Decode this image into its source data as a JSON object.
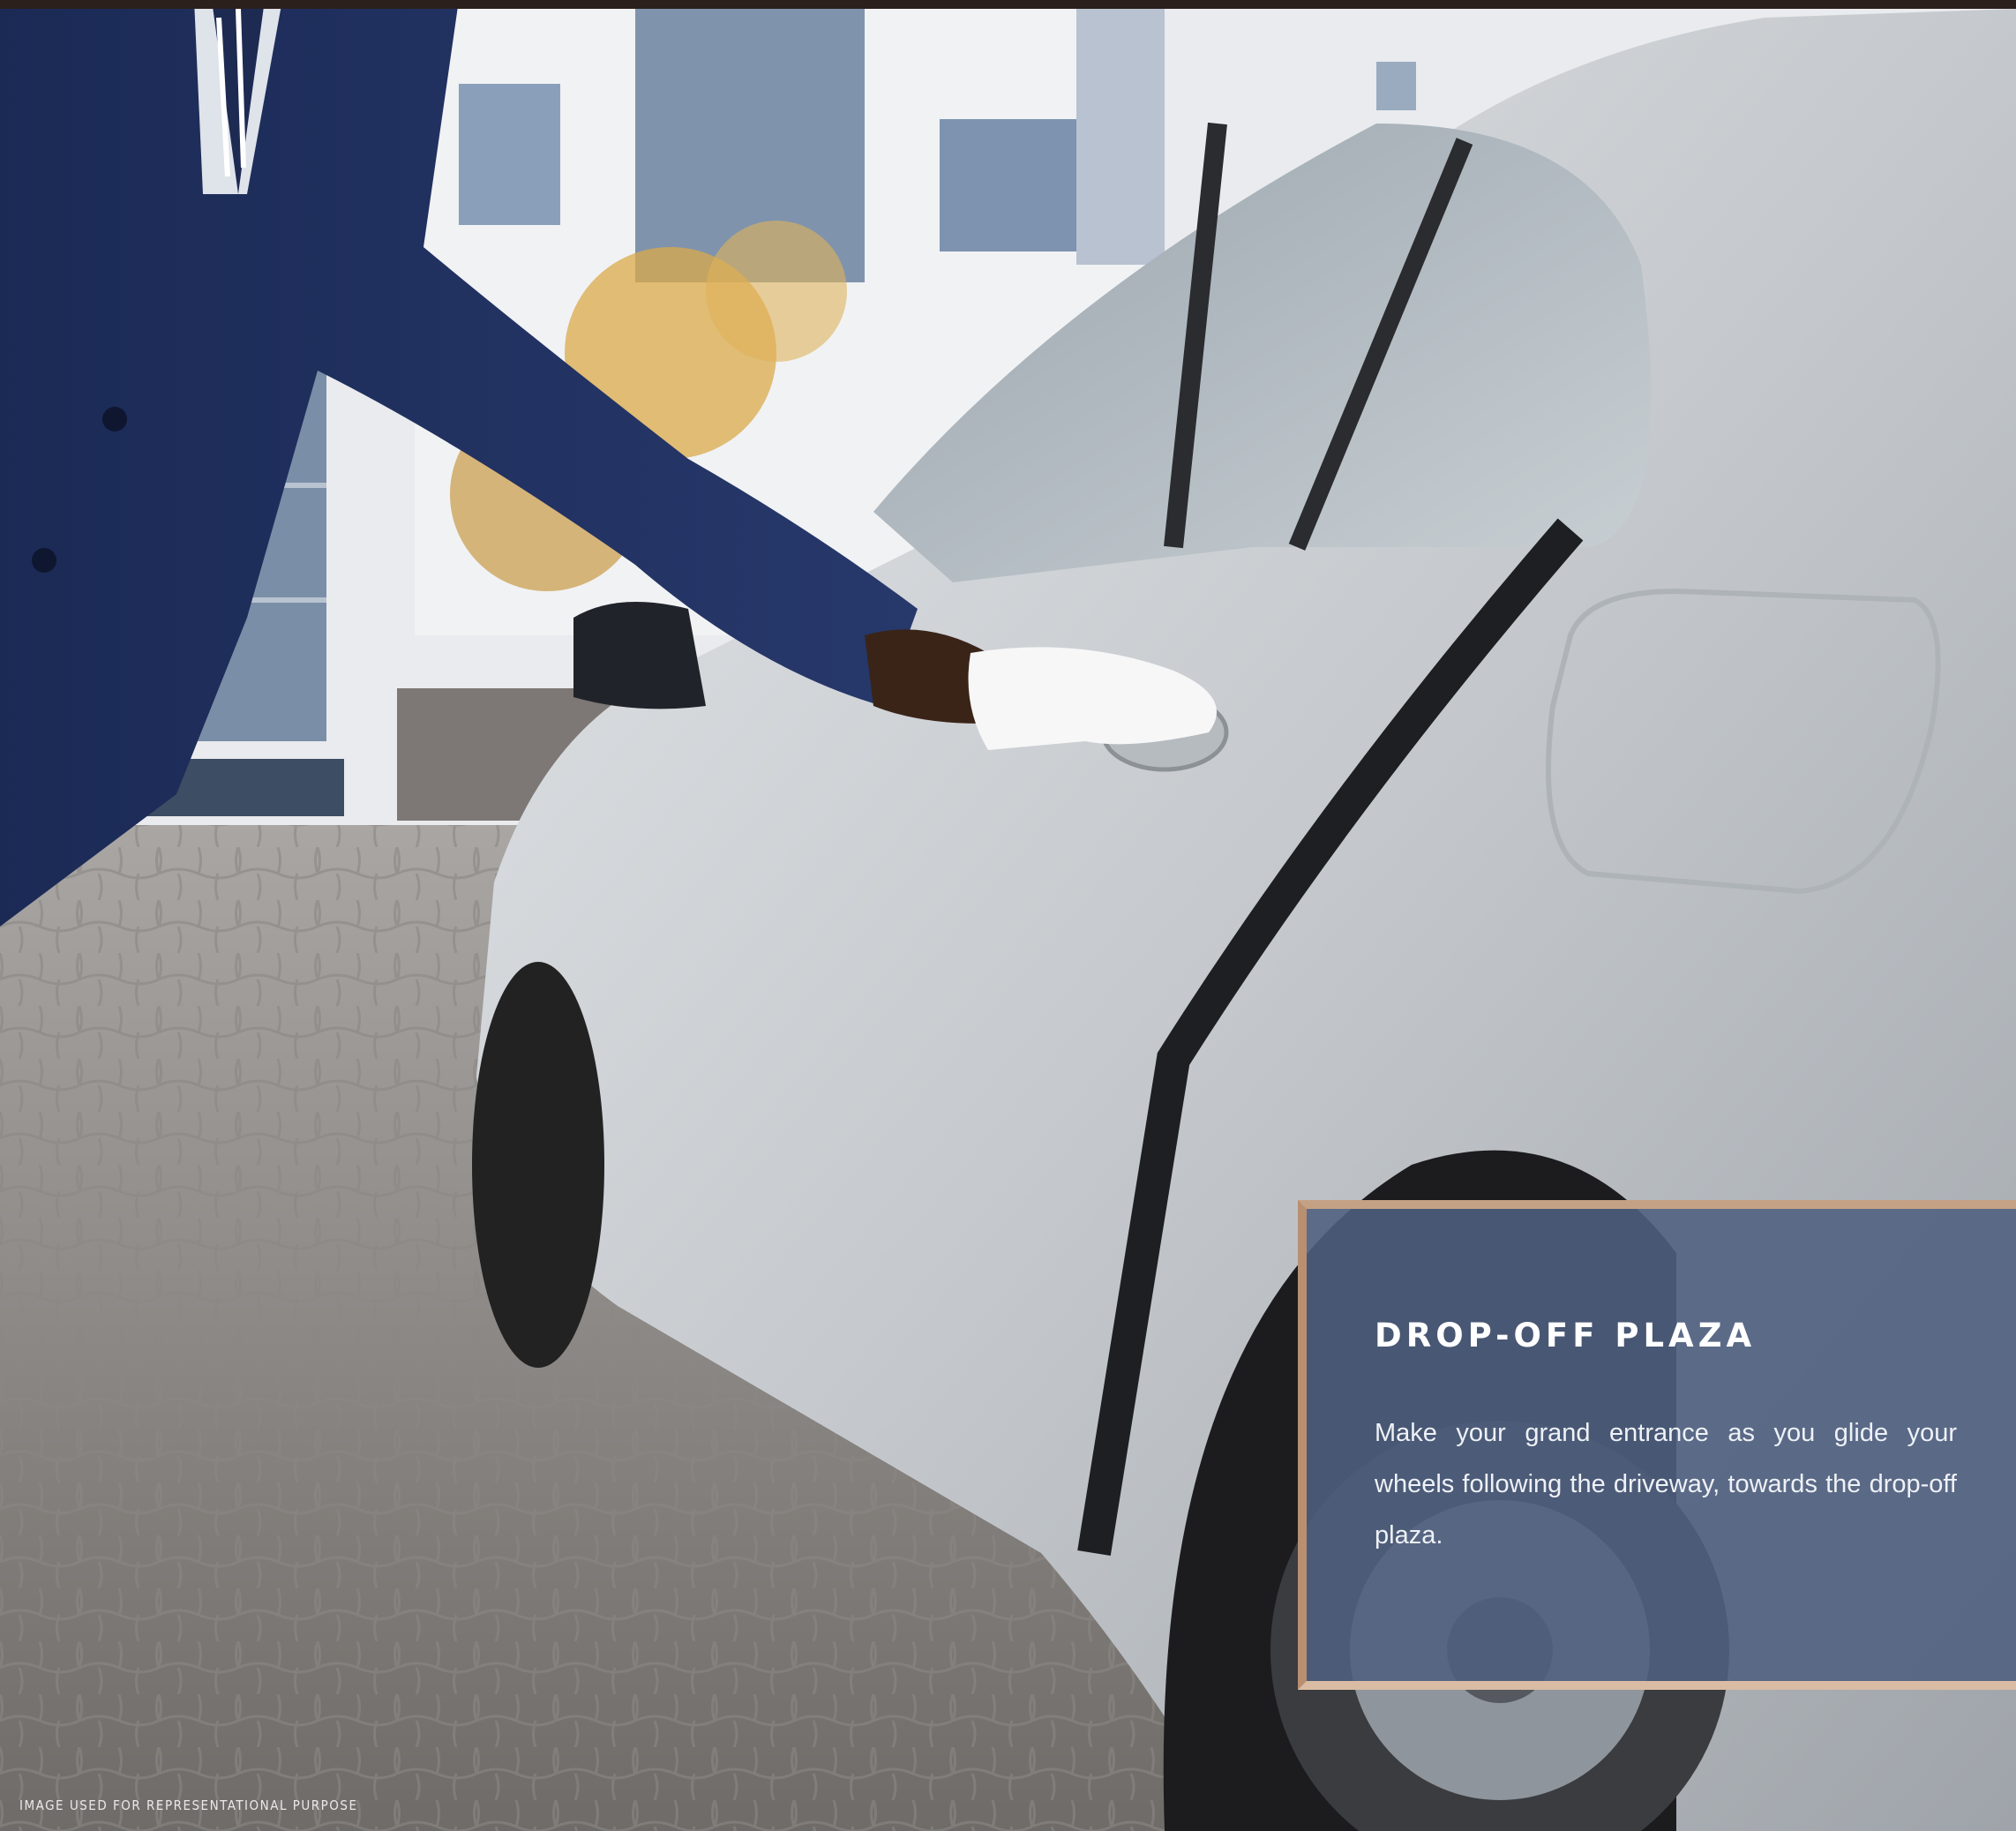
{
  "panel": {
    "title": "DROP-OFF PLAZA",
    "body": "Make your grand entrance as you glide your wheels following the driveway, towards the drop-off plaza."
  },
  "footer": {
    "disclaimer": "IMAGE USED FOR REPRESENTATIONAL PURPOSE"
  },
  "colors": {
    "panel_fill": "#4e6080",
    "frame_gold": "#c4a184",
    "text": "#ffffff"
  }
}
